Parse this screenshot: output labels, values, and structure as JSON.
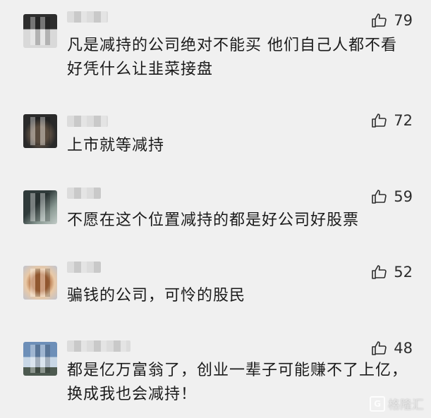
{
  "comments": [
    {
      "likes": "79",
      "text": "凡是减持的公司绝对不能买 他们自己人都不看好凭什么让韭菜接盘",
      "avatar_colors": [
        "#3a3a3a",
        "#d8d8d8"
      ]
    },
    {
      "likes": "72",
      "text": "上市就等减持",
      "avatar_colors": [
        "#2a2a2a",
        "#6b5a4a"
      ]
    },
    {
      "likes": "59",
      "text": "不愿在这个位置减持的都是好公司好股票",
      "avatar_colors": [
        "#2f3a3a",
        "#8a9a94"
      ]
    },
    {
      "likes": "52",
      "text": "骗钱的公司，可怜的股民",
      "avatar_colors": [
        "#b06a3a",
        "#e9c9a6"
      ]
    },
    {
      "likes": "48",
      "text": "都是亿万富翁了，创业一辈子可能赚不了上亿，换成我也会减持！",
      "avatar_colors": [
        "#6d8fb8",
        "#c8d7e6"
      ]
    }
  ],
  "watermark": {
    "logo": "G",
    "text": "格隆汇"
  },
  "colors": {
    "background": "#f0f0f0",
    "text": "#1a1a1a",
    "like_icon": "#2d2d2d"
  },
  "icons": {
    "like": "thumbs-up-icon"
  }
}
